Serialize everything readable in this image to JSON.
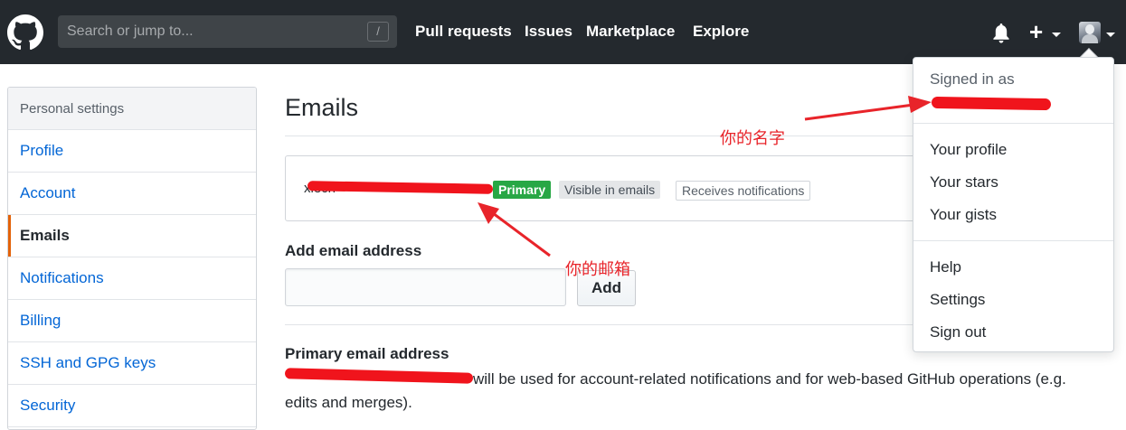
{
  "header": {
    "search_placeholder": "Search or jump to...",
    "search_shortcut": "/",
    "nav": [
      "Pull requests",
      "Issues",
      "Marketplace",
      "Explore"
    ]
  },
  "sidebar": {
    "heading": "Personal settings",
    "items": [
      {
        "label": "Profile",
        "selected": false
      },
      {
        "label": "Account",
        "selected": false
      },
      {
        "label": "Emails",
        "selected": true
      },
      {
        "label": "Notifications",
        "selected": false
      },
      {
        "label": "Billing",
        "selected": false
      },
      {
        "label": "SSH and GPG keys",
        "selected": false
      },
      {
        "label": "Security",
        "selected": false
      }
    ]
  },
  "main": {
    "title": "Emails",
    "email_prefix": "xiech",
    "labels": {
      "primary": "Primary",
      "visible": "Visible in emails",
      "receives": "Receives notifications"
    },
    "add_email_label": "Add email address",
    "add_button": "Add",
    "primary_email_label": "Primary email address",
    "primary_email_desc": "will be used for account-related notifications and for web-based GitHub operations (e.g. edits and merges)."
  },
  "dropdown": {
    "signed_in_as": "Signed in as",
    "group1": [
      "Your profile",
      "Your stars",
      "Your gists"
    ],
    "group2": [
      "Help",
      "Settings",
      "Sign out"
    ]
  },
  "annotations": {
    "name": "你的名字",
    "email": "你的邮箱",
    "color": "#e8242a"
  },
  "colors": {
    "header_bg": "#24292e",
    "link": "#0366d6",
    "primary_badge": "#28a745",
    "selected_accent": "#e36209"
  }
}
